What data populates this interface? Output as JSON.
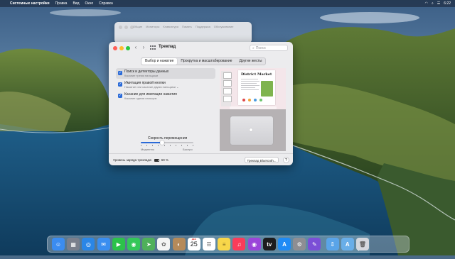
{
  "menubar": {
    "apple": "",
    "app": "Системные настройки",
    "items": [
      "Правка",
      "Вид",
      "Окно",
      "Справка"
    ],
    "clock": "6:22"
  },
  "bg_window": {
    "tabs": [
      "Общие",
      "Мониторы",
      "Клавиатура",
      "Память",
      "Поддержка",
      "Обслуживание"
    ]
  },
  "window": {
    "title": "Трекпад",
    "search_placeholder": "Поиск",
    "tabs": [
      {
        "label": "Выбор и нажатие",
        "active": true
      },
      {
        "label": "Прокрутка и масштабирование",
        "active": false
      },
      {
        "label": "Другие жесты",
        "active": false
      }
    ],
    "options": [
      {
        "title": "Поиск и детекторы данных",
        "subtitle": "Касание тремя пальцами",
        "checked": true,
        "selected": true
      },
      {
        "title": "Имитация правой кнопки",
        "subtitle": "Нажатие или касание двумя пальцами ⌄",
        "checked": true,
        "selected": false
      },
      {
        "title": "Касание для имитации нажатия",
        "subtitle": "Касание одним пальцем",
        "checked": true,
        "selected": false
      }
    ],
    "tracking": {
      "label": "Скорость перемещения",
      "min_label": "Медленно",
      "max_label": "Быстро",
      "level": 0.4
    },
    "battery": {
      "label": "Уровень заряда трекпада:",
      "percent": "69 %",
      "level": 0.69
    },
    "bluetooth_button": "Трекпад Bluetooth...",
    "help_button": "?",
    "preview": {
      "doc_title": "District Market"
    }
  },
  "dock": {
    "icons": [
      {
        "name": "finder-icon",
        "color": "#3b8cf0",
        "glyph": "☺"
      },
      {
        "name": "launchpad-icon",
        "color": "#7a7f8c",
        "glyph": "▦"
      },
      {
        "name": "safari-icon",
        "color": "#2a86e6",
        "glyph": "◎"
      },
      {
        "name": "mail-icon",
        "color": "#3a8ef0",
        "glyph": "✉"
      },
      {
        "name": "facetime-icon",
        "color": "#2cc24a",
        "glyph": "▶"
      },
      {
        "name": "messages-icon",
        "color": "#34c759",
        "glyph": "◉"
      },
      {
        "name": "maps-icon",
        "color": "#4fb05a",
        "glyph": "➤"
      },
      {
        "name": "photos-icon",
        "color": "#f4f4f4",
        "glyph": "✿"
      },
      {
        "name": "contacts-icon",
        "color": "#b58a5a",
        "glyph": "◐"
      },
      {
        "name": "calendar-icon",
        "color": "#ffffff",
        "glyph": ""
      },
      {
        "name": "reminders-icon",
        "color": "#ffffff",
        "glyph": "☰"
      },
      {
        "name": "notes-icon",
        "color": "#f7d64a",
        "glyph": "≡"
      },
      {
        "name": "music-icon",
        "color": "#fa3c5a",
        "glyph": "♫"
      },
      {
        "name": "podcasts-icon",
        "color": "#9b45d9",
        "glyph": "◉"
      },
      {
        "name": "tv-icon",
        "color": "#1c1c1e",
        "glyph": "tv"
      },
      {
        "name": "app-store-icon",
        "color": "#1f8bf5",
        "glyph": "A"
      },
      {
        "name": "system-preferences-icon",
        "color": "#8e8e93",
        "glyph": "⚙"
      },
      {
        "name": "screen-time-icon",
        "color": "#7b4fd6",
        "glyph": "✎"
      },
      {
        "name": "downloads-folder-icon",
        "color": "#5aa4e8",
        "glyph": "⇩"
      },
      {
        "name": "applications-folder-icon",
        "color": "#69aee8",
        "glyph": "A"
      },
      {
        "name": "trash-icon",
        "color": "#d5d8de",
        "glyph": "🗑"
      }
    ],
    "calendar": {
      "month": "ДЕК",
      "day": "25"
    }
  }
}
